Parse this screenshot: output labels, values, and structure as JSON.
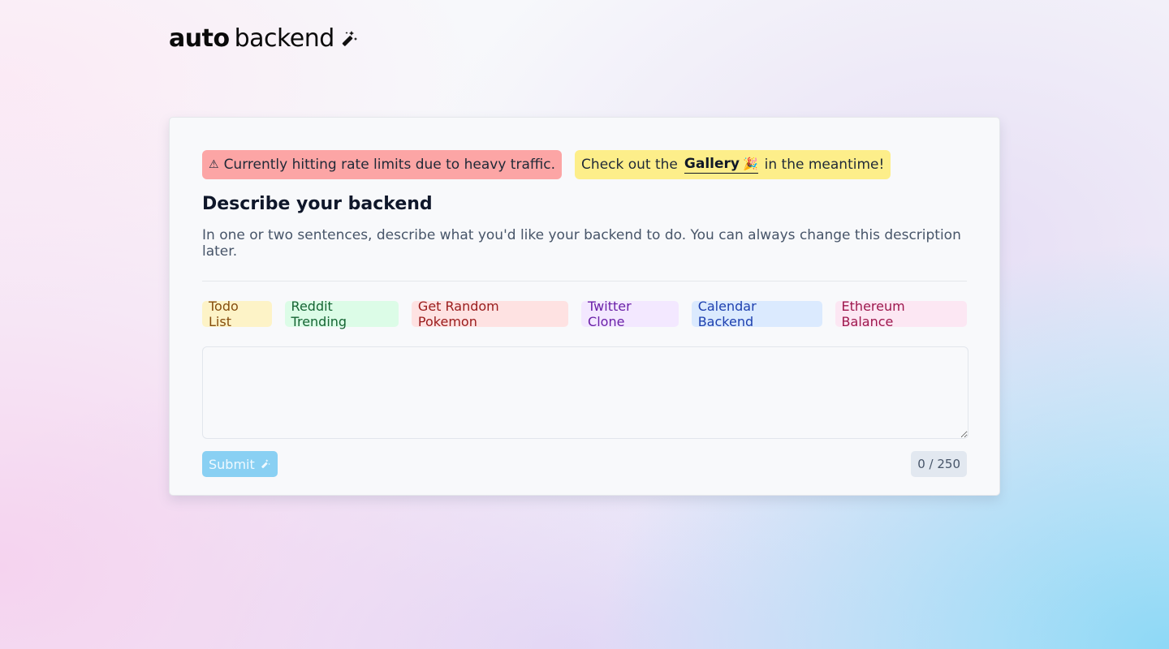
{
  "logo": {
    "bold": "auto",
    "light": "backend",
    "icon": "magic-wand-icon"
  },
  "banners": {
    "rate_limit": {
      "icon": "⚠",
      "text": "Currently hitting rate limits due to heavy traffic.",
      "color": "#fca5a5"
    },
    "gallery": {
      "prefix": "Check out the",
      "link": "Gallery",
      "icon": "🎉",
      "suffix": "in the meantime!",
      "color": "#fdee8a"
    }
  },
  "form": {
    "title": "Describe your backend",
    "subtitle": "In one or two sentences, describe what you'd like your backend to do. You can always change this description later.",
    "textarea_value": "",
    "submit_label": "Submit",
    "counter": "0 / 250"
  },
  "examples": [
    {
      "label": "Todo List",
      "bg": "#fdf3c7",
      "fg": "#854d0e"
    },
    {
      "label": "Reddit Trending",
      "bg": "#dcfce7",
      "fg": "#166534"
    },
    {
      "label": "Get Random Pokemon",
      "bg": "#fee2e2",
      "fg": "#991b1b"
    },
    {
      "label": "Twitter Clone",
      "bg": "#f3e8ff",
      "fg": "#6b21a8"
    },
    {
      "label": "Calendar Backend",
      "bg": "#dbeafe",
      "fg": "#1e40af"
    },
    {
      "label": "Ethereum Balance",
      "bg": "#fce7f3",
      "fg": "#9d174d"
    }
  ]
}
